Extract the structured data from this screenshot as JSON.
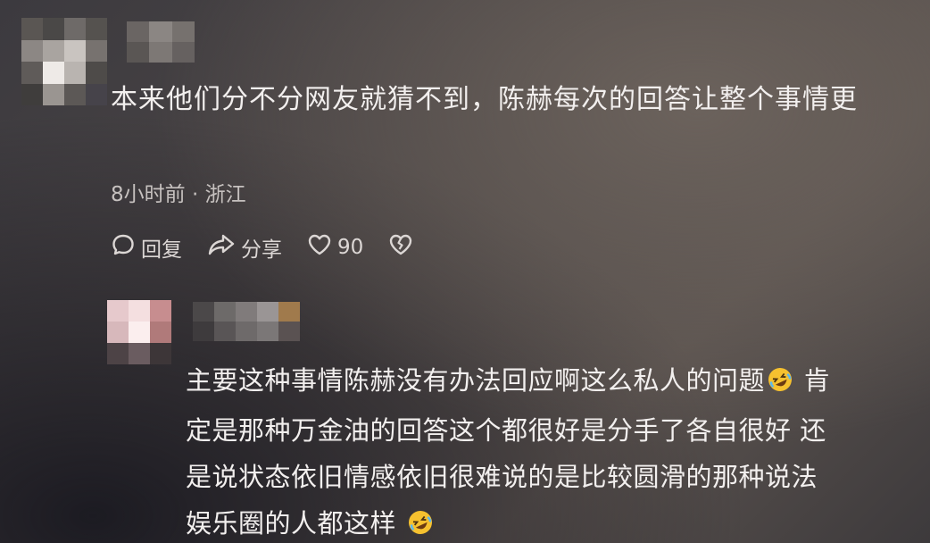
{
  "comment_1": {
    "text": "本来他们分不分网友就猜不到，陈赫每次的回答让整个事情更",
    "meta": "8小时前 · 浙江",
    "actions": {
      "reply_label": "回复",
      "share_label": "分享",
      "like_count": "90"
    },
    "avatar_pixels": [
      "#5a5653",
      "#4a4847",
      "#6e6a68",
      "#55524f",
      "#8c8784",
      "#a9a4a0",
      "#c9c4c0",
      "#77726f",
      "#5f5b59",
      "#eeeae7",
      "#b9b4b0",
      "#4e4b49",
      "#3f3d3c",
      "#9a9591",
      "#5c5856",
      "#46434a"
    ],
    "name_pixels": [
      "#6a6563",
      "#8b8683",
      "#76716e",
      "#5a5654",
      "#7d7875",
      "#666160"
    ]
  },
  "reply_1": {
    "lines": [
      "主要这种事情陈赫没有办法回应啊这么私人的问题",
      "肯",
      "定是那种万金油的回答这个都很好是分手了各自很好 还",
      "是说状态依旧情感依旧很难说的是比较圆滑的那种说法",
      "娱乐圈的人都这样"
    ],
    "emoji_names": [
      "rolling-on-floor-laughing-emoji",
      "rolling-on-floor-laughing-emoji"
    ],
    "avatar_pixels": [
      "#e6c9cc",
      "#f4dfe0",
      "#c78d8f",
      "#d7b8bb",
      "#fbeeee",
      "#b07a7a",
      "#4d4346",
      "#6a5c60",
      "#3d3638"
    ],
    "name_pixels": [
      "#4b4849",
      "#6d6a69",
      "#807b7b",
      "#9a9595",
      "#a07a4c",
      "#3e3b3d",
      "#595556",
      "#6e6a6a",
      "#7b7777",
      "#5a5252"
    ]
  },
  "colors": {
    "text_primary": "#f2efee",
    "text_secondary": "#c6c1bf",
    "emoji_face": "#f6c12f"
  }
}
